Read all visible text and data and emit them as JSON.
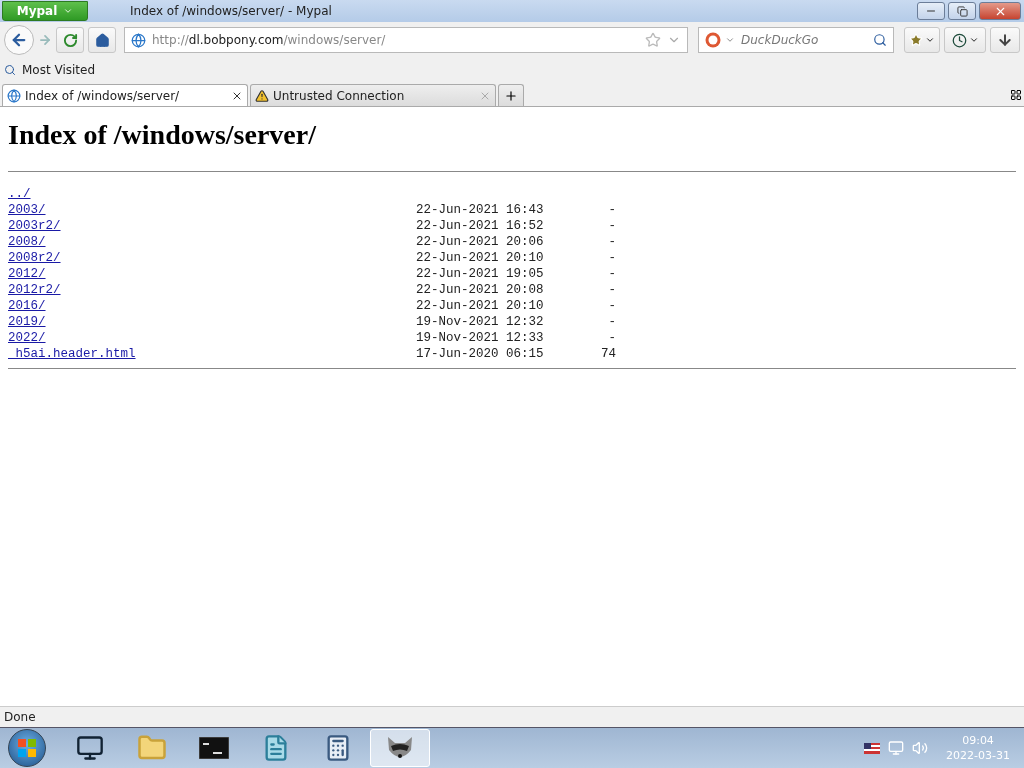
{
  "window": {
    "title": "Index of /windows/server/ - Mypal",
    "app_menu": "Mypal"
  },
  "toolbar": {
    "url_scheme": "http://",
    "url_host": "dl.bobpony.com",
    "url_path": "/windows/server/",
    "search_placeholder": "DuckDuckGo"
  },
  "bookmarks": [
    "Most Visited"
  ],
  "tabs": [
    {
      "label": "Index of /windows/server/",
      "selected": true,
      "kind": "page"
    },
    {
      "label": "Untrusted Connection",
      "selected": false,
      "kind": "warning"
    }
  ],
  "page": {
    "heading": "Index of /windows/server/",
    "entries": [
      {
        "name": "../"
      },
      {
        "name": "2003/",
        "date": "22-Jun-2021 16:43",
        "size": "-"
      },
      {
        "name": "2003r2/",
        "date": "22-Jun-2021 16:52",
        "size": "-"
      },
      {
        "name": "2008/",
        "date": "22-Jun-2021 20:06",
        "size": "-"
      },
      {
        "name": "2008r2/",
        "date": "22-Jun-2021 20:10",
        "size": "-"
      },
      {
        "name": "2012/",
        "date": "22-Jun-2021 19:05",
        "size": "-"
      },
      {
        "name": "2012r2/",
        "date": "22-Jun-2021 20:08",
        "size": "-"
      },
      {
        "name": "2016/",
        "date": "22-Jun-2021 20:10",
        "size": "-"
      },
      {
        "name": "2019/",
        "date": "19-Nov-2021 12:32",
        "size": "-"
      },
      {
        "name": "2022/",
        "date": "19-Nov-2021 12:33",
        "size": "-"
      },
      {
        "name": "_h5ai.header.html",
        "date": "17-Jun-2020 06:15",
        "size": "74"
      }
    ]
  },
  "status_bar": "Done",
  "taskbar": {
    "apps": [
      {
        "kind": "network",
        "selected": false
      },
      {
        "kind": "folder",
        "selected": false
      },
      {
        "kind": "terminal",
        "selected": false
      },
      {
        "kind": "notepad",
        "selected": false
      },
      {
        "kind": "calculator",
        "selected": false
      },
      {
        "kind": "raccoon",
        "selected": true
      }
    ],
    "time": "09:04",
    "date": "2022-03-31"
  }
}
